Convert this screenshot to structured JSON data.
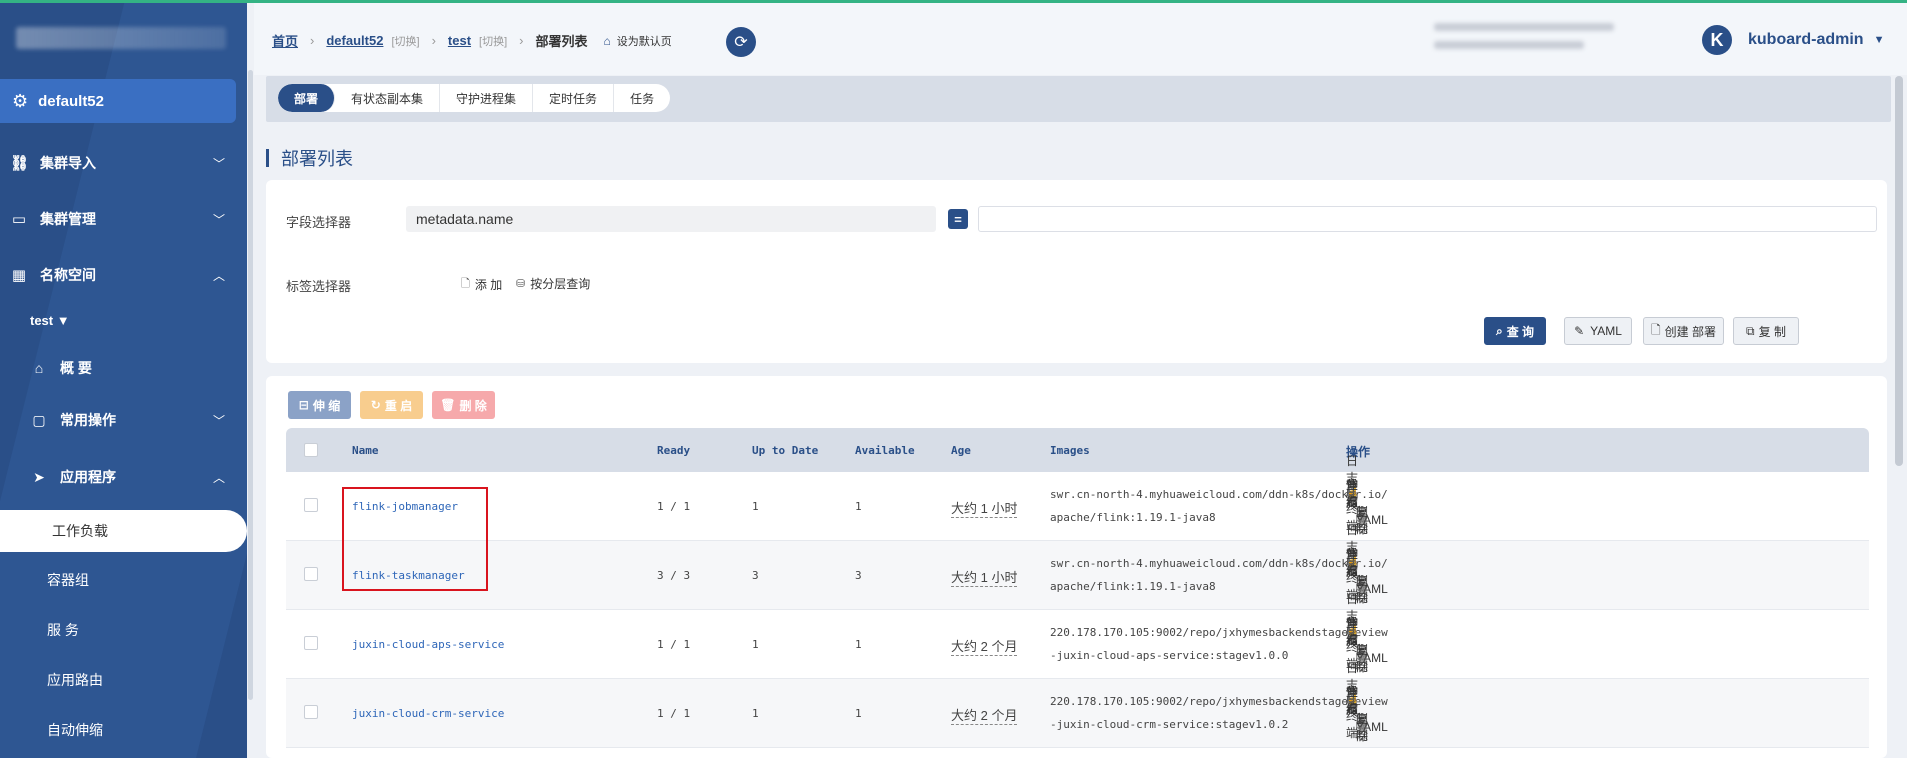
{
  "sidebar": {
    "cluster": "default52",
    "menu": [
      {
        "label": "集群导入",
        "icon": "link-icon"
      },
      {
        "label": "集群管理",
        "icon": "server-icon"
      },
      {
        "label": "名称空间",
        "icon": "grid-icon"
      }
    ],
    "namespace": "test",
    "sub": [
      {
        "label": "概 要",
        "icon": "home-icon"
      },
      {
        "label": "常用操作",
        "icon": "folder-icon"
      },
      {
        "label": "应用程序",
        "icon": "send-icon"
      }
    ],
    "active": "工作负载",
    "leaves": [
      "容器组",
      "服 务",
      "应用路由",
      "自动伸缩"
    ]
  },
  "header": {
    "crumb_home": "首页",
    "crumb_cluster": "default52",
    "crumb_switch": "[切换]",
    "crumb_ns": "test",
    "crumb_current": "部署列表",
    "set_default": "设为默认页",
    "user": "kuboard-admin",
    "avatar_letter": "K"
  },
  "tabs": [
    "部署",
    "有状态副本集",
    "守护进程集",
    "定时任务",
    "任务"
  ],
  "page_title": "部署列表",
  "filter": {
    "field_label": "字段选择器",
    "field_value": "metadata.name",
    "eq": "=",
    "label_label": "标签选择器",
    "add": "添 加",
    "by_layer": "按分层查询",
    "buttons": {
      "query": "查 询",
      "yaml": "YAML",
      "create": "创建 部署",
      "copy": "复 制"
    }
  },
  "actions": {
    "scale": "伸 缩",
    "restart": "重 启",
    "delete": "删 除"
  },
  "columns": [
    "Name",
    "Ready",
    "Up to Date",
    "Available",
    "Age",
    "Images",
    "操作"
  ],
  "rows": [
    {
      "name": "flink-jobmanager",
      "ready": "1 / 1",
      "uptodate": "1",
      "available": "1",
      "age": "大约 1 小时",
      "img1": "swr.cn-north-4.myhuaweicloud.com/ddn-k8s/docker.io/",
      "img2": "apache/flink:1.19.1-java8"
    },
    {
      "name": "flink-taskmanager",
      "ready": "3 / 3",
      "uptodate": "3",
      "available": "3",
      "age": "大约 1 小时",
      "img1": "swr.cn-north-4.myhuaweicloud.com/ddn-k8s/docker.io/",
      "img2": "apache/flink:1.19.1-java8"
    },
    {
      "name": "juxin-cloud-aps-service",
      "ready": "1 / 1",
      "uptodate": "1",
      "available": "1",
      "age": "大约 2 个月",
      "img1": "220.178.170.105:9002/repo/jxhymesbackendstagereview",
      "img2": "-juxin-cloud-aps-service:stagev1.0.0"
    },
    {
      "name": "juxin-cloud-crm-service",
      "ready": "1 / 1",
      "uptodate": "1",
      "available": "1",
      "age": "大约 2 个月",
      "img1": "220.178.170.105:9002/repo/jxhymesbackendstagereview",
      "img2": "-juxin-cloud-crm-service:stagev1.0.2"
    }
  ],
  "ops": {
    "view": "查 看",
    "logs": "日志 / 终端",
    "scale": "伸 缩",
    "restart": "重 启",
    "copy": "复 制",
    "yaml": "YAML",
    "delete": "删 除"
  }
}
